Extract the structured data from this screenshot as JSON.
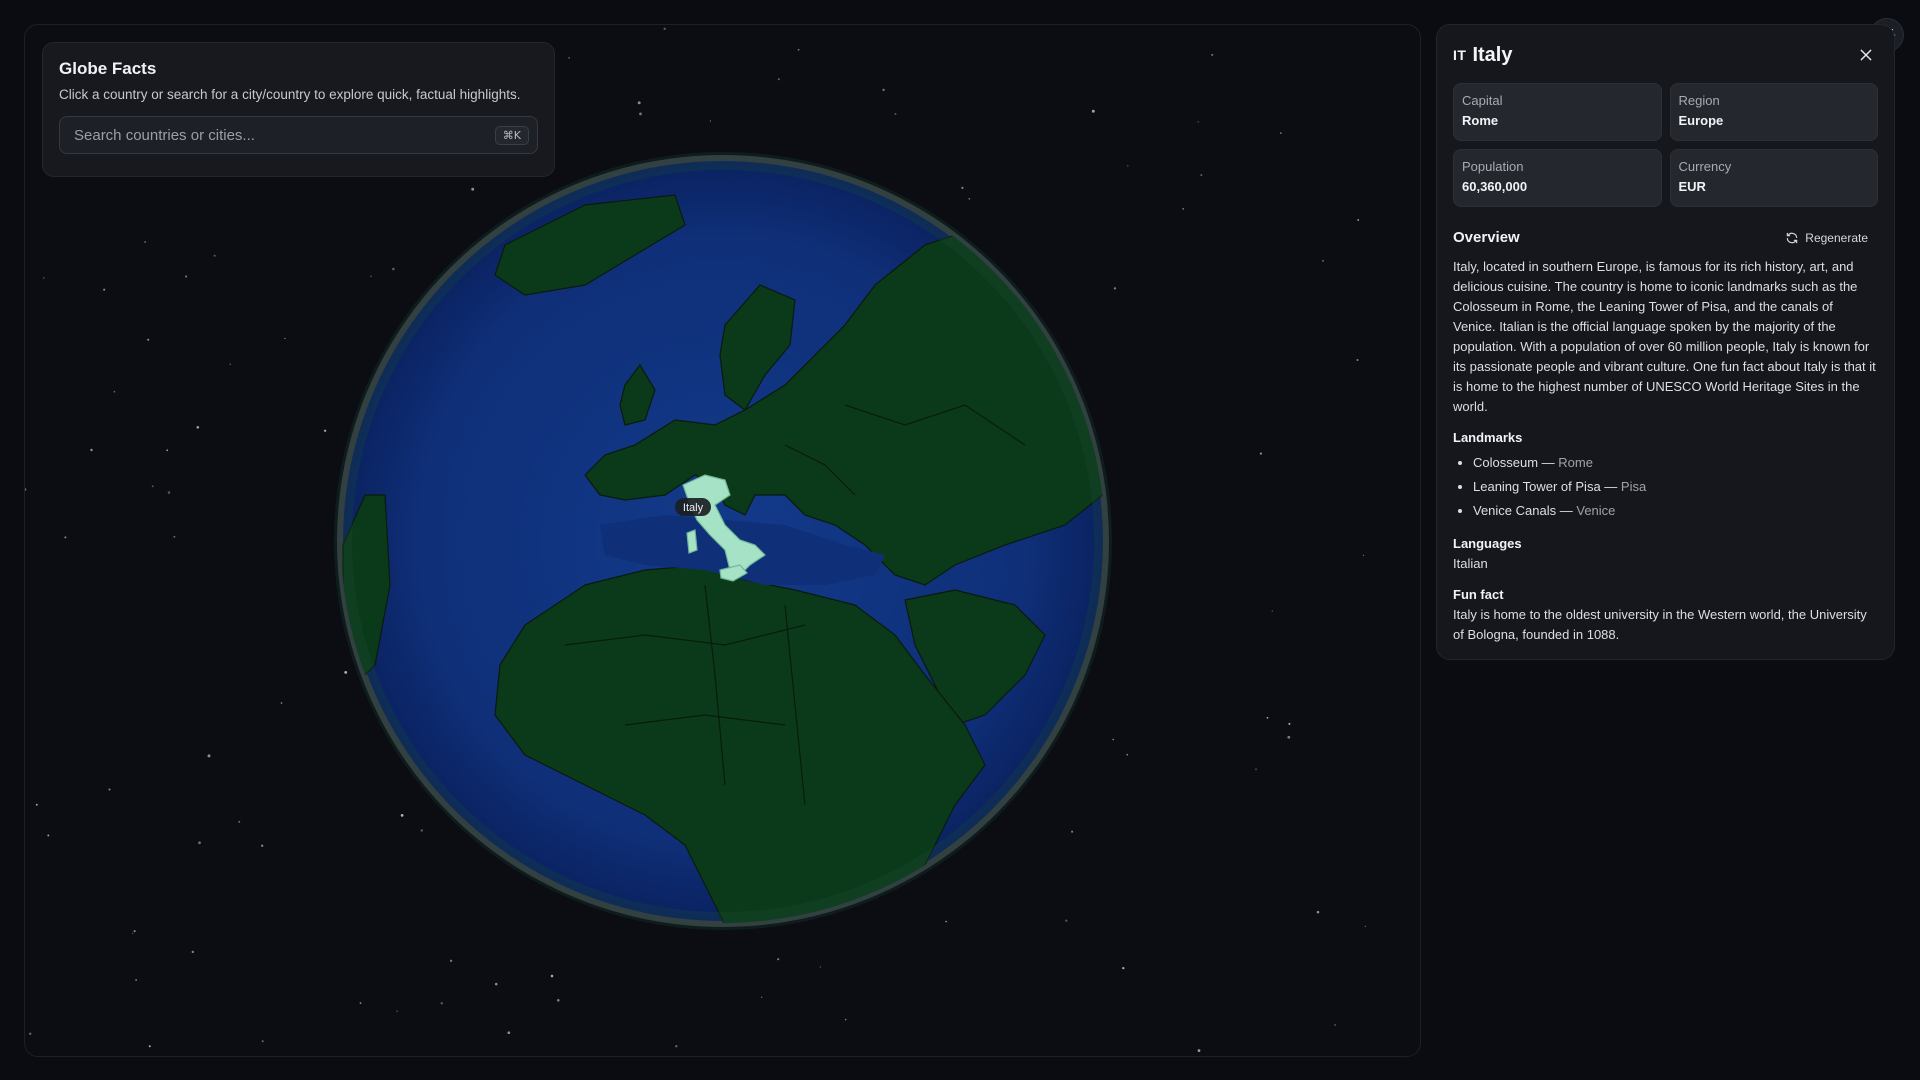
{
  "app": {
    "title": "Globe Facts",
    "subtitle": "Click a country or search for a city/country to explore quick, factual highlights.",
    "search": {
      "placeholder": "Search countries or cities...",
      "shortcut": "⌘K"
    }
  },
  "globe": {
    "hover_label": "Italy",
    "colors": {
      "ocean": "#0e2a6e",
      "land": "#0b3a1a",
      "selected": "#a6e3c6",
      "rim": "#3a3d44"
    }
  },
  "panel": {
    "flag_code": "IT",
    "country": "Italy",
    "stats": [
      {
        "label": "Capital",
        "value": "Rome"
      },
      {
        "label": "Region",
        "value": "Europe"
      },
      {
        "label": "Population",
        "value": "60,360,000"
      },
      {
        "label": "Currency",
        "value": "EUR"
      }
    ],
    "overview_title": "Overview",
    "regenerate_label": "Regenerate",
    "overview": "Italy, located in southern Europe, is famous for its rich history, art, and delicious cuisine. The country is home to iconic landmarks such as the Colosseum in Rome, the Leaning Tower of Pisa, and the canals of Venice. Italian is the official language spoken by the majority of the population. With a population of over 60 million people, Italy is known for its passionate people and vibrant culture. One fun fact about Italy is that it is home to the highest number of UNESCO World Heritage Sites in the world.",
    "landmarks_title": "Landmarks",
    "landmarks": [
      {
        "name": "Colosseum",
        "sep": " — ",
        "city": "Rome"
      },
      {
        "name": "Leaning Tower of Pisa",
        "sep": " — ",
        "city": "Pisa"
      },
      {
        "name": "Venice Canals",
        "sep": " — ",
        "city": "Venice"
      }
    ],
    "languages_title": "Languages",
    "languages": "Italian",
    "funfact_title": "Fun fact",
    "funfact": "Italy is home to the oldest university in the Western world, the University of Bologna, founded in 1088."
  }
}
